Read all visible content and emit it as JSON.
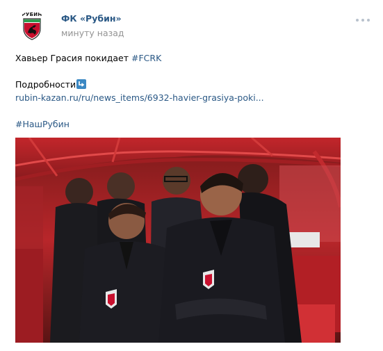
{
  "post": {
    "author": "ФК «Рубин»",
    "time": "минуту назад",
    "avatar_text": "РУБИН",
    "line1_text": "Хавьер Грасия покидает ",
    "line1_hashtag": "#FCRK",
    "details_label": "Подробности",
    "details_icon": "down-right-arrow-icon",
    "link": "rubin-kazan.ru/ru/news_items/6932-havier-grasiya-poki...",
    "hashtag2": "#НашРубин"
  },
  "colors": {
    "link": "#2a5885",
    "muted": "#939393",
    "emoji_blue": "#3b88c3"
  }
}
